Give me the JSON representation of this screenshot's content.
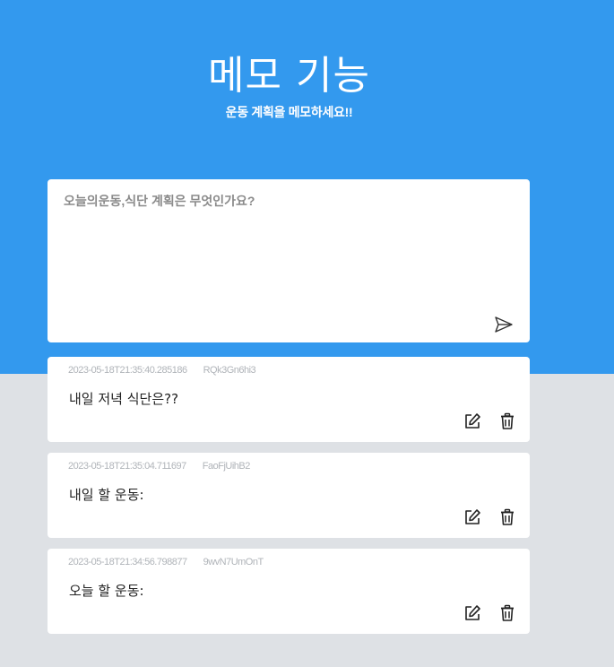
{
  "header": {
    "title": "메모 기능",
    "subtitle": "운동 계획을 메모하세요!!"
  },
  "composer": {
    "placeholder": "오늘의운동,식단 계획은 무엇인가요?",
    "value": "",
    "send_icon": "send-icon"
  },
  "memos": [
    {
      "timestamp": "2023-05-18T21:35:40.285186",
      "id": "RQk3Gn6hi3",
      "text": "내일 저녁 식단은??"
    },
    {
      "timestamp": "2023-05-18T21:35:04.711697",
      "id": "FaoFjUihB2",
      "text": "내일 할 운동:"
    },
    {
      "timestamp": "2023-05-18T21:34:56.798877",
      "id": "9wvN7UmOnT",
      "text": "오늘 할 운동:"
    }
  ],
  "colors": {
    "accent": "#3399ee",
    "background": "#dee1e5",
    "card": "#ffffff",
    "meta_text": "#b0b4b9"
  }
}
